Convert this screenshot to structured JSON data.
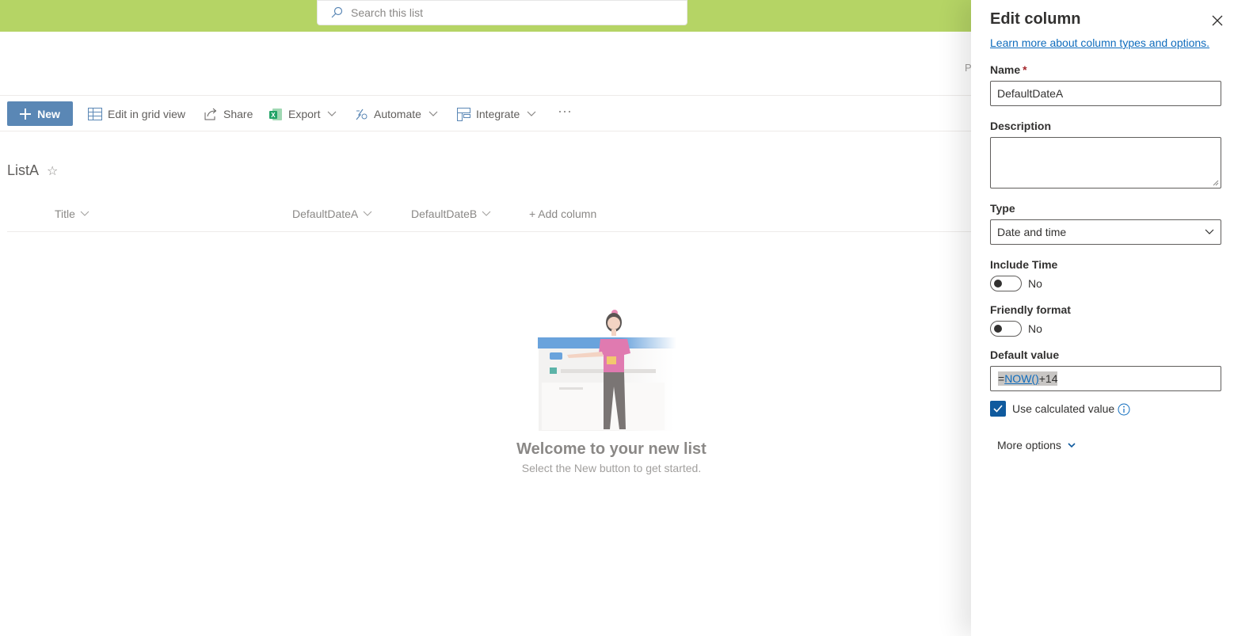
{
  "colors": {
    "suite_bar": "#b5d465",
    "primary": "#5a87b5",
    "link": "#0f6cbd",
    "checkbox": "#0f5a9e",
    "excel": "#21a366"
  },
  "search": {
    "placeholder": "Search this list",
    "icon": "search-icon"
  },
  "commandbar": {
    "new_label": "New",
    "edit_grid_label": "Edit in grid view",
    "share_label": "Share",
    "export_label": "Export",
    "automate_label": "Automate",
    "integrate_label": "Integrate",
    "more_label": "···"
  },
  "list": {
    "title": "ListA",
    "star": "☆",
    "columns": [
      "Title",
      "DefaultDateA",
      "DefaultDateB"
    ],
    "add_column_label": "+ Add column",
    "peek_text": "P"
  },
  "empty_state": {
    "title": "Welcome to your new list",
    "subtitle": "Select the New button to get started."
  },
  "panel": {
    "title": "Edit column",
    "learn_more": "Learn more about column types and options.",
    "name_label": "Name",
    "name_required": "*",
    "name_value": "DefaultDateA",
    "description_label": "Description",
    "description_value": "",
    "type_label": "Type",
    "type_value": "Date and time",
    "include_time_label": "Include Time",
    "include_time_value": "No",
    "friendly_format_label": "Friendly format",
    "friendly_format_value": "No",
    "default_value_label": "Default value",
    "default_value_parts": [
      "=",
      "NOW()",
      "+14"
    ],
    "use_calculated_label": "Use calculated value",
    "use_calculated_checked": true,
    "more_options_label": "More options"
  }
}
